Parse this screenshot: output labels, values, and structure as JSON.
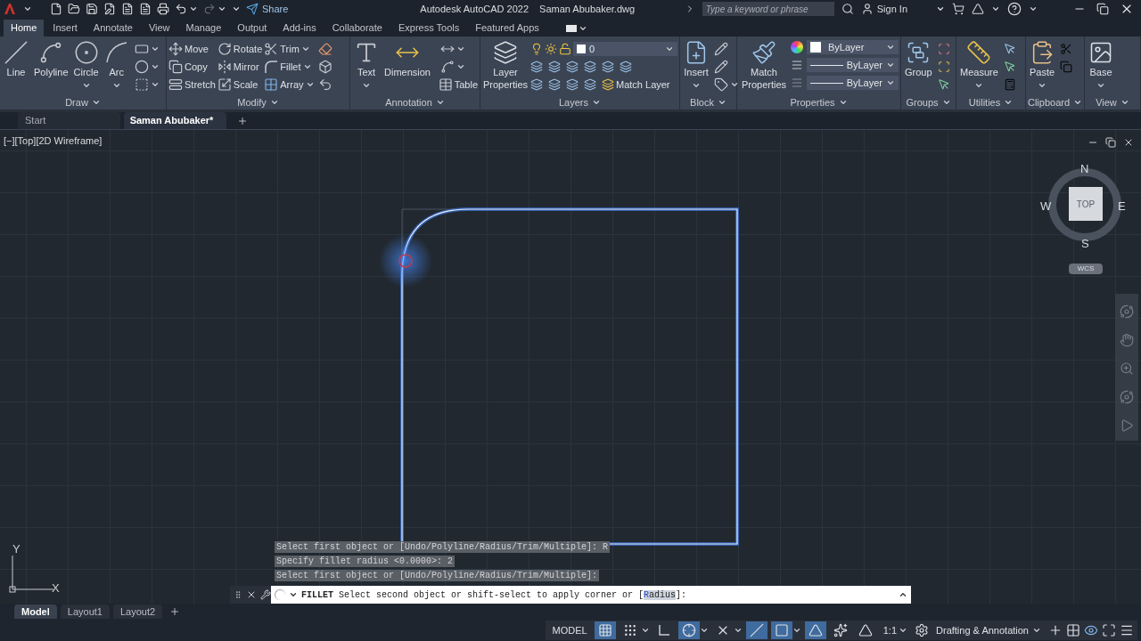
{
  "title_bar": {
    "share": "Share",
    "app_title": "Autodesk AutoCAD 2022",
    "file_name": "Saman Abubaker.dwg",
    "search": {
      "placeholder": "Type a keyword or phrase"
    },
    "sign_in": "Sign In"
  },
  "ribbon_tabs": [
    {
      "label": "Home",
      "selected": true
    },
    {
      "label": "Insert",
      "selected": false
    },
    {
      "label": "Annotate",
      "selected": false
    },
    {
      "label": "View",
      "selected": false
    },
    {
      "label": "Manage",
      "selected": false
    },
    {
      "label": "Output",
      "selected": false
    },
    {
      "label": "Add-ins",
      "selected": false
    },
    {
      "label": "Collaborate",
      "selected": false
    },
    {
      "label": "Express Tools",
      "selected": false
    },
    {
      "label": "Featured Apps",
      "selected": false
    }
  ],
  "ribbon_panels": [
    {
      "kind": "draw",
      "title": "Draw",
      "buttons": [
        "Line",
        "Polyline",
        "Circle",
        "Arc"
      ]
    },
    {
      "kind": "modify",
      "title": "Modify",
      "buttons": [
        "Move",
        "Copy",
        "Stretch",
        "Rotate",
        "Mirror",
        "Scale",
        "Trim",
        "Fillet",
        "Array"
      ]
    },
    {
      "kind": "annotation",
      "title": "Annotation",
      "buttons": [
        "Text",
        "Dimension",
        "Table"
      ]
    },
    {
      "kind": "layers",
      "title": "Layers",
      "buttons": [
        "Layer Properties",
        "Match Layer"
      ],
      "current_layer": "0"
    },
    {
      "kind": "block",
      "title": "Block",
      "buttons": [
        "Insert"
      ]
    },
    {
      "kind": "properties",
      "title": "Properties",
      "buttons": [
        "Match Properties"
      ],
      "color_setting": "ByLayer",
      "lineweight": "ByLayer",
      "linetype": "ByLayer"
    },
    {
      "kind": "groups",
      "title": "Groups",
      "buttons": [
        "Group"
      ]
    },
    {
      "kind": "utilities",
      "title": "Utilities",
      "buttons": [
        "Measure"
      ]
    },
    {
      "kind": "clipboard",
      "title": "Clipboard",
      "buttons": [
        "Paste"
      ]
    },
    {
      "kind": "view",
      "title": "View",
      "buttons": [
        "Base"
      ]
    }
  ],
  "document_tabs": [
    {
      "label": "Start",
      "selected": false
    },
    {
      "label": "Saman Abubaker*",
      "selected": true
    }
  ],
  "viewport": {
    "label": "[−][Top][2D Wireframe]",
    "viewcube": {
      "top": "TOP",
      "north": "N",
      "south": "S",
      "east": "E",
      "west": "W",
      "ucs": "WCS"
    },
    "ucs_axes": {
      "x": "X",
      "y": "Y"
    }
  },
  "command_history": [
    "Select first object or [Undo/Polyline/Radius/Trim/Multiple]: R",
    "Specify fillet radius <0.0000>: 2",
    "Select first object or [Undo/Polyline/Radius/Trim/Multiple]:"
  ],
  "command_line": {
    "command": "FILLET",
    "prompt": "Select second object or shift-select to apply corner or [",
    "option": "Radius",
    "end": "]:"
  },
  "layout_tabs": [
    {
      "label": "Model",
      "selected": true
    },
    {
      "label": "Layout1",
      "selected": false
    },
    {
      "label": "Layout2",
      "selected": false
    }
  ],
  "status_bar": {
    "space": "MODEL",
    "toggles": [
      {
        "kind": "grid",
        "on": true
      },
      {
        "kind": "snap",
        "on": false
      },
      {
        "kind": "ortho",
        "on": false
      },
      {
        "kind": "polar",
        "on": true
      },
      {
        "kind": "isodraft",
        "on": false
      },
      {
        "kind": "tracking",
        "on": true
      },
      {
        "kind": "osnap",
        "on": true
      },
      {
        "kind": "annovis",
        "on": true
      },
      {
        "kind": "autoscale",
        "on": false
      },
      {
        "kind": "annoscale",
        "on": false
      }
    ],
    "annotation_scale": "1:1",
    "workspace": "Drafting & Annotation"
  }
}
